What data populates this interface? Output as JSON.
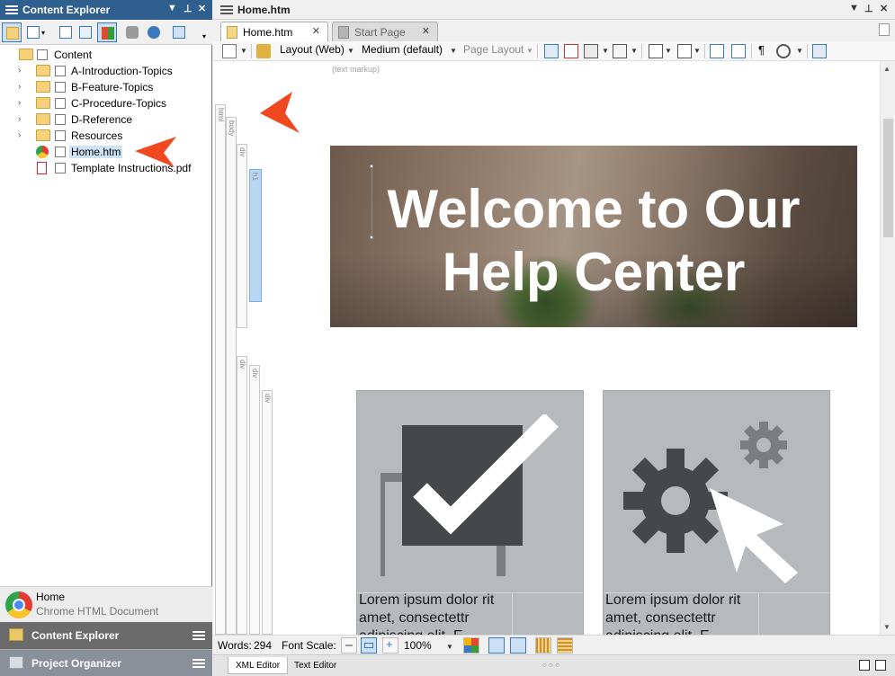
{
  "left_pane": {
    "title": "Content Explorer",
    "tree": {
      "root": "Content",
      "folders": [
        "A-Introduction-Topics",
        "B-Feature-Topics",
        "C-Procedure-Topics",
        "D-Reference",
        "Resources"
      ],
      "files": [
        {
          "name": "Home.htm",
          "icon": "chrome-icon",
          "selected": true
        },
        {
          "name": "Template Instructions.pdf",
          "icon": "pdf-icon",
          "selected": false
        }
      ]
    },
    "info": {
      "name": "Home",
      "type": "Chrome HTML Document"
    },
    "panes": [
      "Content Explorer",
      "Project Organizer"
    ]
  },
  "document": {
    "title": "Home.htm",
    "tabs": [
      {
        "label": "Home.htm",
        "active": true
      },
      {
        "label": "Start Page",
        "active": false
      }
    ],
    "toolbar": {
      "layout": "Layout (Web)",
      "medium": "Medium (default)",
      "page_layout": "Page Layout"
    },
    "markup_hint": "(text markup)",
    "structure_bars": [
      "html",
      "body",
      "div",
      "h1",
      "div",
      "div",
      "div"
    ],
    "hero_heading": "Welcome to Our Help Center",
    "cards": [
      {
        "text": "Lorem ipsum dolor rit amet, consectettr adipiscing elit. E"
      },
      {
        "text": "Lorem ipsum dolor rit amet, consectettr adipiscing elit. E"
      }
    ],
    "status": {
      "words_label": "Words:",
      "words": "294",
      "font_scale_label": "Font Scale:",
      "zoom": "100%"
    },
    "bottom_tabs": [
      "XML Editor",
      "Text Editor"
    ],
    "bottom_dots": "○ ○ ○"
  },
  "colors": {
    "pane_title": "#2f5f8f",
    "pane_button": "#6b6b6b",
    "pane_button_alt": "#8a9099",
    "callout_arrow": "#f0491f",
    "card_bg": "#b6babd",
    "icon_dark": "#464748"
  }
}
